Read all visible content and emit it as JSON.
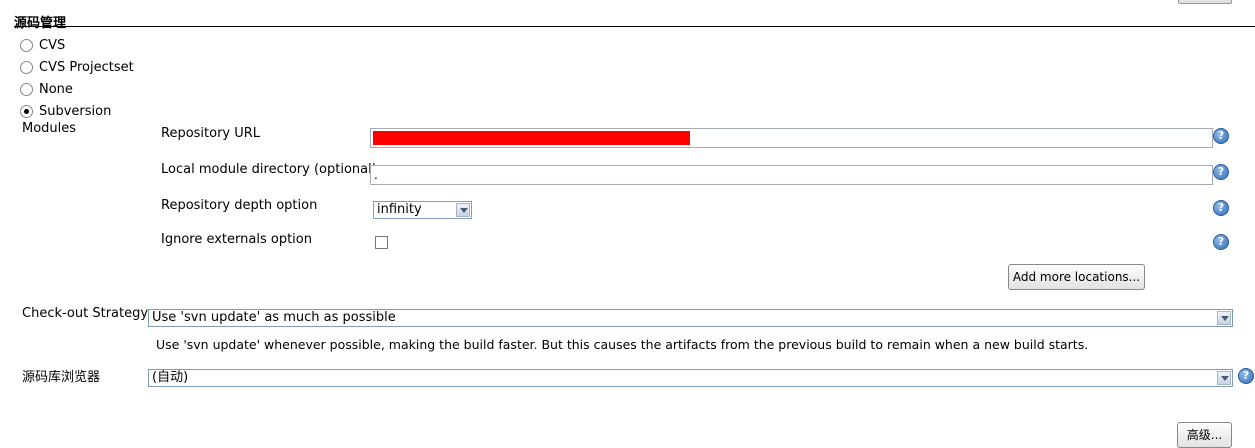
{
  "section": {
    "title": "源码管理"
  },
  "scm_options": [
    {
      "label": "CVS",
      "selected": false
    },
    {
      "label": "CVS Projectset",
      "selected": false
    },
    {
      "label": "None",
      "selected": false
    },
    {
      "label": "Subversion",
      "selected": true
    }
  ],
  "modules": {
    "label": "Modules",
    "repository_url": {
      "label": "Repository URL",
      "value": ""
    },
    "local_module_dir": {
      "label": "Local module directory (optional)",
      "value": "."
    },
    "depth": {
      "label": "Repository depth option",
      "value": "infinity"
    },
    "ignore_externals": {
      "label": "Ignore externals option",
      "checked": false
    },
    "add_more_label": "Add more locations..."
  },
  "checkout": {
    "label": "Check-out Strategy",
    "value": "Use 'svn update' as much as possible",
    "description": "Use 'svn update' whenever possible, making the build faster. But this causes the artifacts from the previous build to remain when a new build starts."
  },
  "browser": {
    "label": "源码库浏览器",
    "value": "(自动)"
  },
  "advanced_label": "高级...",
  "help_glyph": "?",
  "icons": {
    "help": "help-icon",
    "select_arrow": "chevron-down-icon"
  }
}
